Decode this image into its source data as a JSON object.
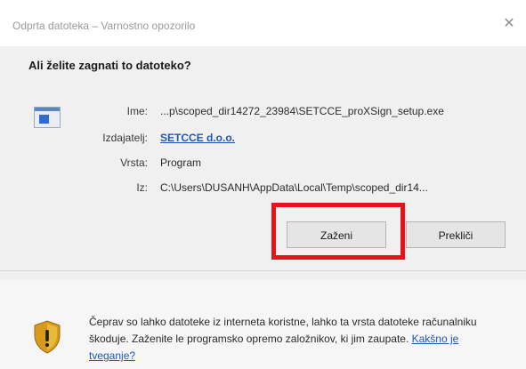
{
  "window": {
    "title": "Odprta datoteka – Varnostno opozorilo",
    "close_symbol": "✕"
  },
  "dialog": {
    "question": "Ali želite zagnati to datoteko?",
    "fields": {
      "name_label": "Ime:",
      "name_value": "...p\\scoped_dir14272_23984\\SETCCE_proXSign_setup.exe",
      "publisher_label": "Izdajatelj:",
      "publisher_value": "SETCCE d.o.o.",
      "type_label": "Vrsta:",
      "type_value": "Program",
      "from_label": "Iz:",
      "from_value": "C:\\Users\\DUSANH\\AppData\\Local\\Temp\\scoped_dir14..."
    },
    "buttons": {
      "run": "Zaženi",
      "cancel": "Prekliči"
    },
    "highlight_color": "#e8121b"
  },
  "footer": {
    "warning_text": "Čeprav so lahko datoteke iz interneta koristne, lahko ta vrsta datoteke računalniku škoduje. Zaženite le programsko opremo založnikov, ki jim zaupate.",
    "risk_link": "Kakšno je tveganje?"
  },
  "icons": {
    "file": "program-file-icon",
    "shield": "security-shield-warning-icon",
    "close": "close-icon"
  }
}
